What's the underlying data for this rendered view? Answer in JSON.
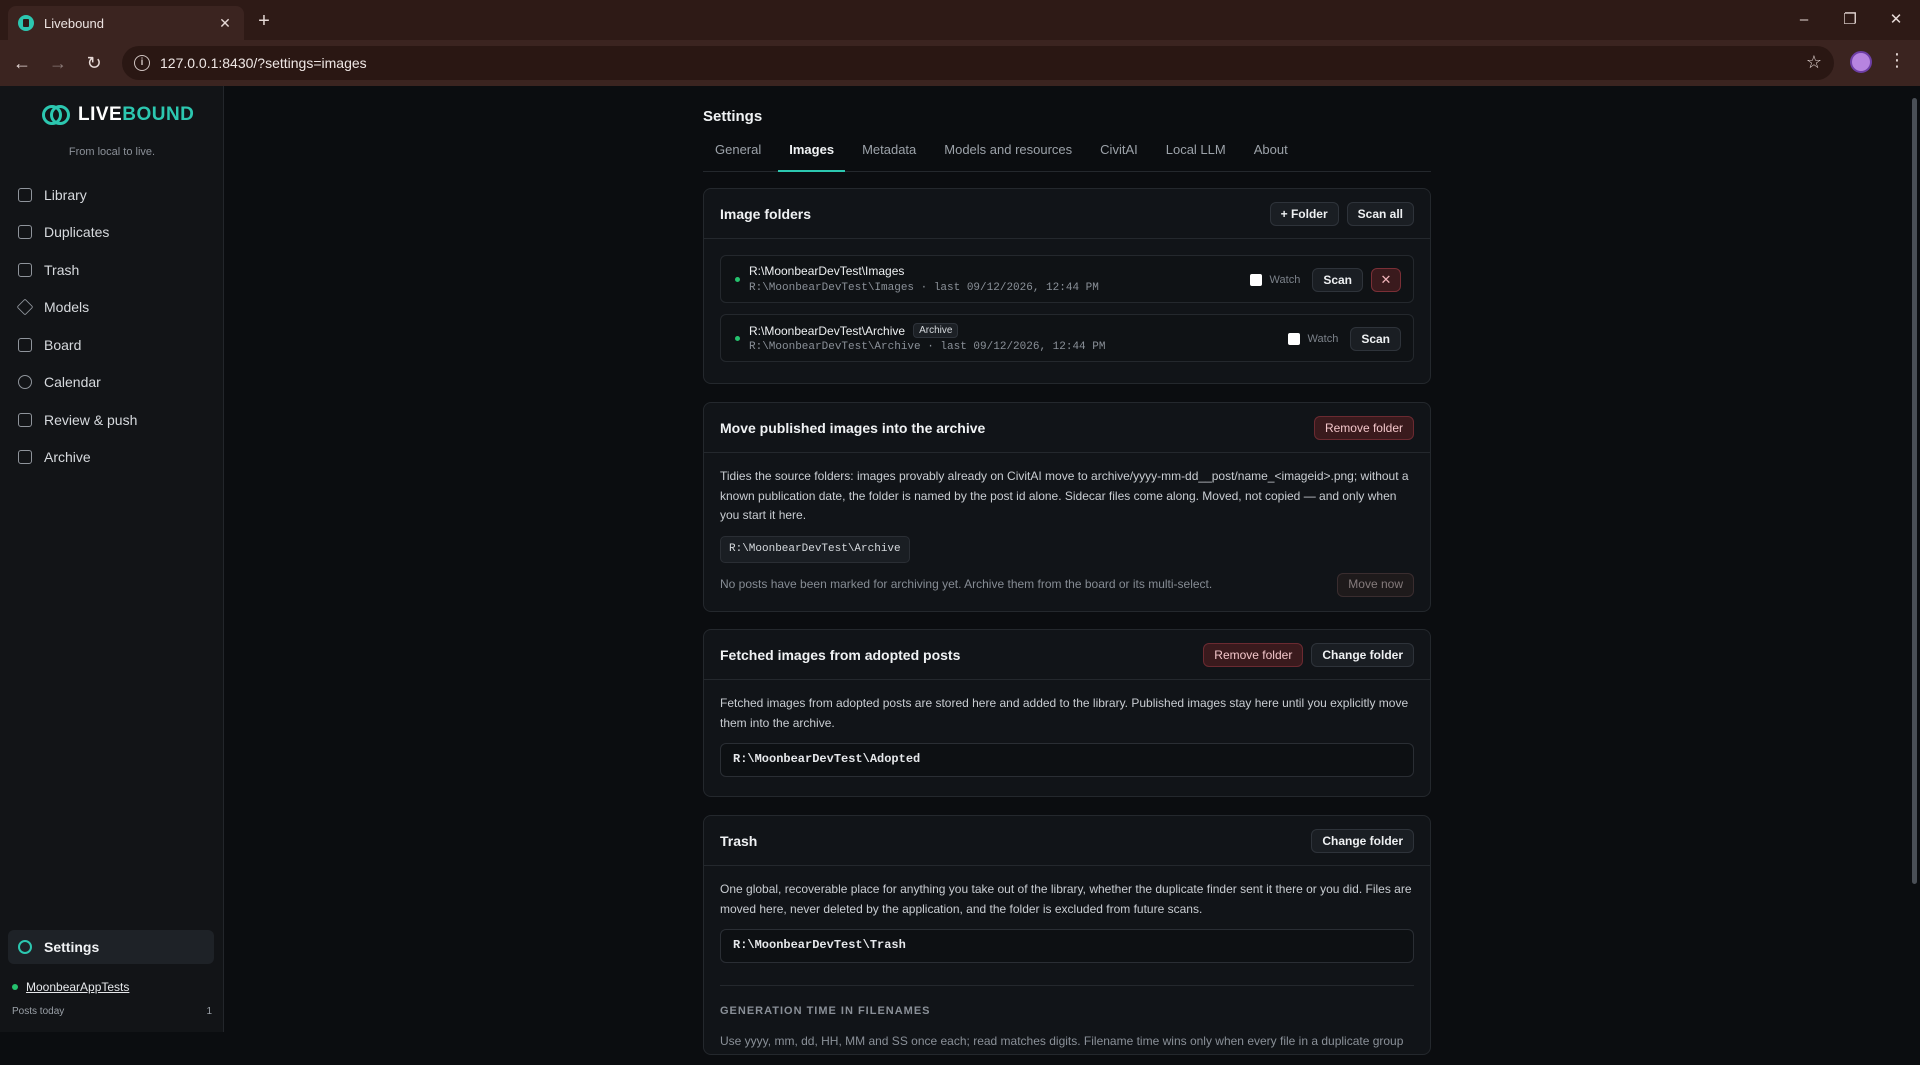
{
  "browser": {
    "tab_title": "Livebound",
    "url": "127.0.0.1:8430/?settings=images"
  },
  "sidebar": {
    "logo_prefix": "LIVE",
    "logo_suffix": "BOUND",
    "tagline": "From local to live.",
    "items": [
      {
        "label": "Library",
        "icon": "library-icon"
      },
      {
        "label": "Duplicates",
        "icon": "duplicates-icon"
      },
      {
        "label": "Trash",
        "icon": "trash-icon"
      },
      {
        "label": "Models",
        "icon": "models-icon"
      },
      {
        "label": "Board",
        "icon": "board-icon"
      },
      {
        "label": "Calendar",
        "icon": "calendar-icon"
      },
      {
        "label": "Review & push",
        "icon": "review-icon"
      },
      {
        "label": "Archive",
        "icon": "archive-icon"
      }
    ],
    "settings_label": "Settings",
    "account_name": "MoonbearAppTests",
    "posts_today_label": "Posts today",
    "posts_today_value": "1"
  },
  "settings": {
    "title": "Settings",
    "tabs": [
      "General",
      "Images",
      "Metadata",
      "Models and resources",
      "CivitAI",
      "Local LLM",
      "About"
    ],
    "active_tab": "Images"
  },
  "image_folders": {
    "title": "Image folders",
    "add_folder_label": "+ Folder",
    "scan_all_label": "Scan all",
    "folders": [
      {
        "name": "R:\\MoonbearDevTest\\Images",
        "meta": "R:\\MoonbearDevTest\\Images · last 09/12/2026, 12:44 PM",
        "badge": "",
        "watch_label": "Watch",
        "scan_label": "Scan",
        "remove": "✕"
      },
      {
        "name": "R:\\MoonbearDevTest\\Archive",
        "meta": "R:\\MoonbearDevTest\\Archive · last 09/12/2026, 12:44 PM",
        "badge": "Archive",
        "watch_label": "Watch",
        "scan_label": "Scan"
      }
    ]
  },
  "archive_card": {
    "title": "Move published images into the archive",
    "remove_folder_label": "Remove folder",
    "description": "Tidies the source folders: images provably already on CivitAI move to archive/yyyy-mm-dd__post/name_<imageid>.png; without a known publication date, the folder is named by the post id alone. Sidecar files come along. Moved, not copied — and only when you start it here.",
    "path": "R:\\MoonbearDevTest\\Archive",
    "note": "No posts have been marked for archiving yet. Archive them from the board or its multi-select.",
    "move_now_label": "Move now"
  },
  "adopted_card": {
    "title": "Fetched images from adopted posts",
    "remove_folder_label": "Remove folder",
    "change_folder_label": "Change folder",
    "description": "Fetched images from adopted posts are stored here and added to the library. Published images stay here until you explicitly move them into the archive.",
    "path": "R:\\MoonbearDevTest\\Adopted"
  },
  "trash_card": {
    "title": "Trash",
    "change_folder_label": "Change folder",
    "description": "One global, recoverable place for anything you take out of the library, whether the duplicate finder sent it there or you did. Files are moved here, never deleted by the application, and the folder is excluded from future scans.",
    "path": "R:\\MoonbearDevTest\\Trash",
    "section_caption": "GENERATION TIME IN FILENAMES",
    "section_text": "Use yyyy, mm, dd, HH, MM and SS once each; read matches digits. Filename time wins only when every file in a duplicate group"
  },
  "colors": {
    "accent": "#2cc7b0",
    "online": "#25c26e",
    "danger": "#3a1a1d"
  }
}
